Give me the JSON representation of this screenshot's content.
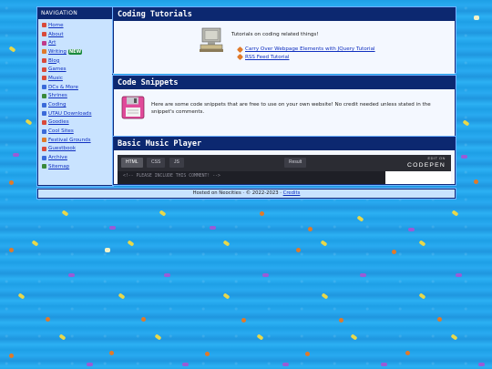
{
  "sidebar": {
    "title": "NAVIGATION",
    "items": [
      {
        "label": "Home",
        "icon": "house-icon",
        "color": "#d94a3a"
      },
      {
        "label": "About",
        "icon": "person-icon",
        "color": "#d94a3a"
      },
      {
        "label": "Art",
        "icon": "brush-icon",
        "color": "#c03a8a"
      },
      {
        "label": "Writing",
        "icon": "pencil-icon",
        "color": "#e07a2a",
        "badge": "NEW"
      },
      {
        "label": "Blog",
        "icon": "pen-icon",
        "color": "#d94a3a"
      },
      {
        "label": "Games",
        "icon": "controller-icon",
        "color": "#d94a3a"
      },
      {
        "label": "Music",
        "icon": "note-icon",
        "color": "#d94a3a"
      },
      {
        "label": "DCs & More",
        "icon": "disc-icon",
        "color": "#3a6ad9"
      },
      {
        "label": "Shrines",
        "icon": "shrine-icon",
        "color": "#3a8a3a"
      },
      {
        "label": "Coding",
        "icon": "code-icon",
        "color": "#3a6ad9"
      },
      {
        "label": "UTAU Downloads",
        "icon": "download-icon",
        "color": "#3a6ad9"
      },
      {
        "label": "Goodies",
        "icon": "gift-icon",
        "color": "#d94a3a"
      },
      {
        "label": "Cool Sites",
        "icon": "globe-icon",
        "color": "#3a6ad9"
      },
      {
        "label": "Festival Grounds",
        "icon": "flag-icon",
        "color": "#e07a2a"
      },
      {
        "label": "Guestbook",
        "icon": "book-icon",
        "color": "#d94a3a"
      },
      {
        "label": "Archive",
        "icon": "folder-icon",
        "color": "#3a6ad9"
      },
      {
        "label": "Sitemap",
        "icon": "map-icon",
        "color": "#3a8a3a"
      }
    ]
  },
  "tutorials": {
    "title": "Coding Tutorials",
    "intro": "Tutorials on coding related things!",
    "links": [
      "Carry Over Webpage Elements with JQuery Tutorial",
      "RSS Feed Tutorial"
    ]
  },
  "snippets": {
    "title": "Code Snippets",
    "text": "Here are some code snippets that are free to use on your own website! No credit needed unless stated in the snippet's comments."
  },
  "music": {
    "title": "Basic Music Player",
    "tabs": [
      "HTML",
      "CSS",
      "JS"
    ],
    "result_label": "Result",
    "logo_small": "EDIT ON",
    "logo_big": "CODEPEN",
    "code_line": "<!-- PLEASE INCLUDE THIS COMMENT! -->"
  },
  "footer": {
    "text": "Hosted on Neocities · © 2022-2023 · ",
    "credits_label": "Credits"
  },
  "colors": {
    "accent": "#0c2870",
    "link": "#1030c0",
    "background": "#1e9fe6"
  }
}
